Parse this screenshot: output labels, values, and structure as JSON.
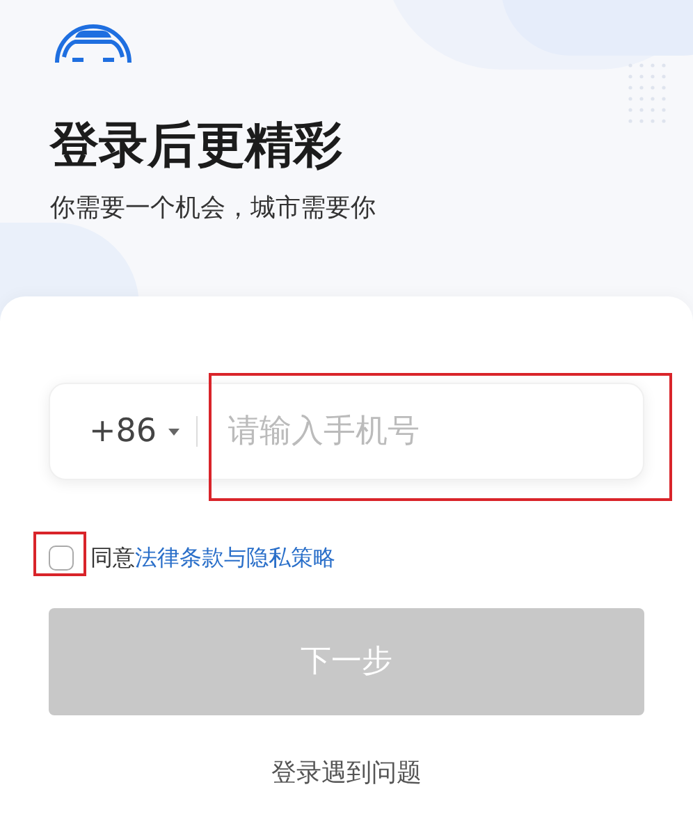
{
  "header": {
    "title": "登录后更精彩",
    "subtitle": "你需要一个机会，城市需要你"
  },
  "phone": {
    "country_code": "+86",
    "placeholder": "请输入手机号",
    "highlighted": true
  },
  "agreement": {
    "checked": false,
    "highlighted": true,
    "prefix": "同意",
    "link": "法律条款与隐私策略"
  },
  "next_button": {
    "label": "下一步",
    "disabled": true
  },
  "help_link": "登录遇到问题"
}
